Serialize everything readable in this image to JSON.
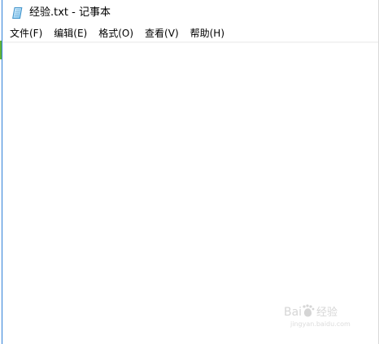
{
  "window": {
    "title": "经验.txt - 记事本"
  },
  "menu": {
    "items": [
      {
        "label": "文件(F)"
      },
      {
        "label": "编辑(E)"
      },
      {
        "label": "格式(O)"
      },
      {
        "label": "查看(V)"
      },
      {
        "label": "帮助(H)"
      }
    ]
  },
  "editor": {
    "text": ""
  },
  "watermark": {
    "brand": "Baidu经验",
    "url": "jingyan.baidu.com"
  },
  "icons": {
    "app": "notepad-icon",
    "watermark": "baidu-watermark-logo"
  }
}
